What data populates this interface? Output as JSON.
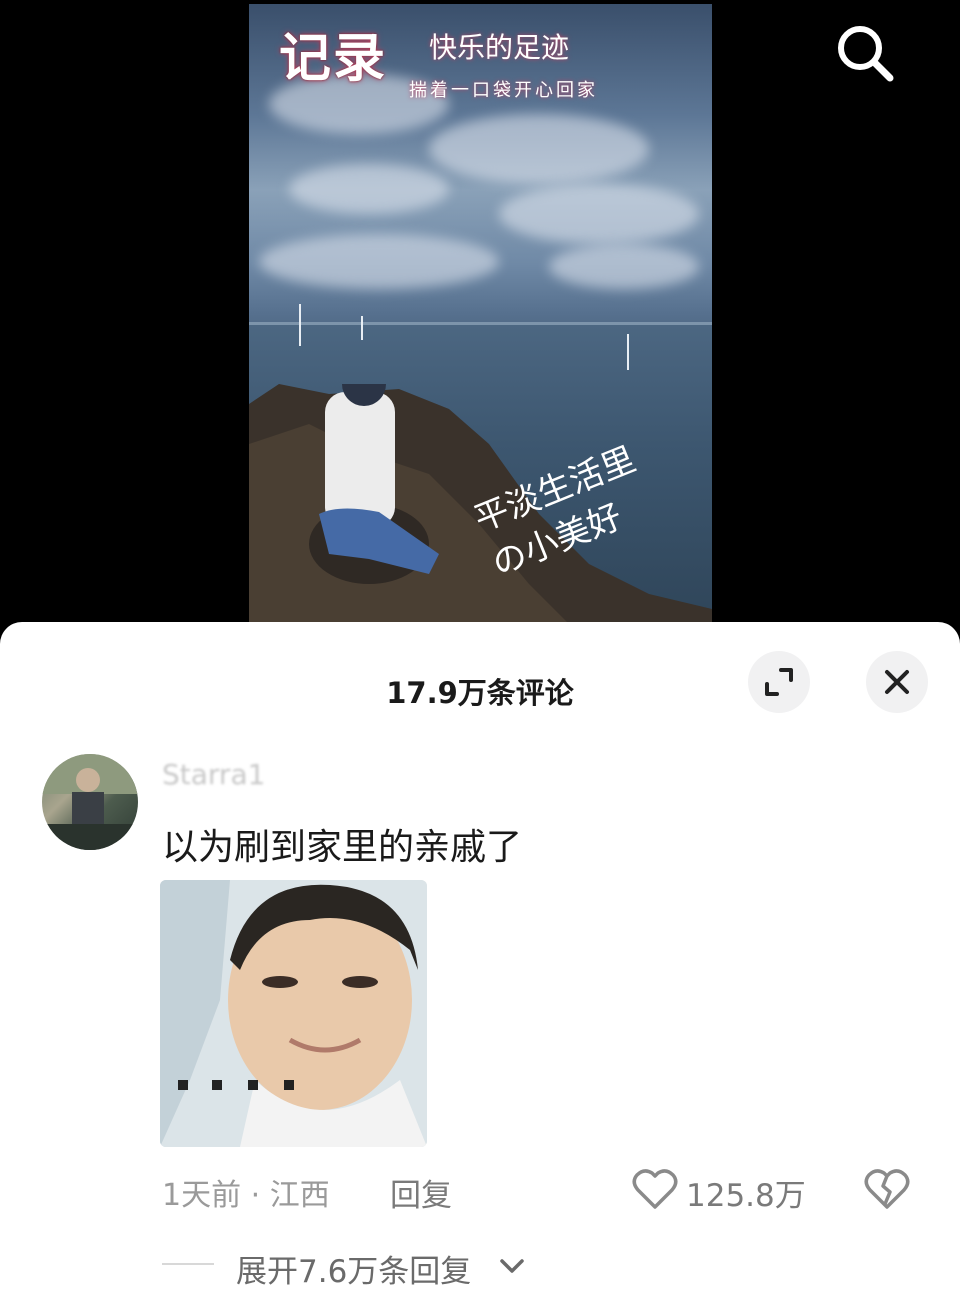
{
  "video": {
    "title_main": "记录",
    "title_side": "快乐的足迹",
    "subtitle": "揣着一口袋开心回家",
    "handwriting_line1": "平淡生活里",
    "handwriting_line2": "の小美好"
  },
  "header": {
    "search_icon": "search-icon"
  },
  "sheet": {
    "title": "17.9万条评论",
    "expand_icon": "expand-icon",
    "close_icon": "close-icon"
  },
  "comment": {
    "username": "Starra1",
    "text": "以为刷到家里的亲戚了",
    "time_location": "1天前 · 江西",
    "reply_label": "回复",
    "like_count": "125.8万",
    "expand_replies": "展开7.6万条回复"
  },
  "colors": {
    "sheet_bg": "#ffffff",
    "secondary_text": "#9a9a9a",
    "primary_text": "#1a1a1a"
  }
}
